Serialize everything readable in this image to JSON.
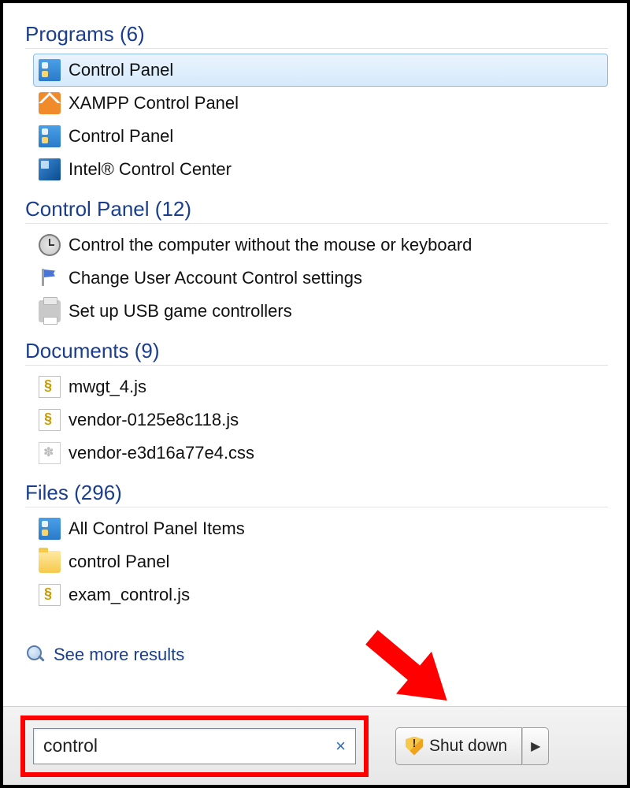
{
  "sections": {
    "programs": {
      "label": "Programs",
      "count": "(6)",
      "items": [
        {
          "label": "Control Panel",
          "icon": "cp",
          "selected": true
        },
        {
          "label": "XAMPP Control Panel",
          "icon": "xampp",
          "selected": false
        },
        {
          "label": "Control Panel",
          "icon": "cp",
          "selected": false
        },
        {
          "label": "Intel® Control Center",
          "icon": "intel",
          "selected": false
        }
      ]
    },
    "controlpanel": {
      "label": "Control Panel",
      "count": "(12)",
      "items": [
        {
          "label": "Control the computer without the mouse or keyboard",
          "icon": "clock"
        },
        {
          "label": "Change User Account Control settings",
          "icon": "flag"
        },
        {
          "label": "Set up USB game controllers",
          "icon": "printer"
        }
      ]
    },
    "documents": {
      "label": "Documents",
      "count": "(9)",
      "items": [
        {
          "label": "mwgt_4.js",
          "icon": "js"
        },
        {
          "label": "vendor-0125e8c118.js",
          "icon": "js"
        },
        {
          "label": "vendor-e3d16a77e4.css",
          "icon": "css"
        }
      ]
    },
    "files": {
      "label": "Files",
      "count": "(296)",
      "items": [
        {
          "label": "All Control Panel Items",
          "icon": "cp"
        },
        {
          "label": "control Panel",
          "icon": "folder"
        },
        {
          "label": "exam_control.js",
          "icon": "js"
        }
      ]
    }
  },
  "see_more": "See more results",
  "search": {
    "value": "control",
    "clear_glyph": "×"
  },
  "shutdown": {
    "label": "Shut down",
    "arrow_glyph": "▶"
  }
}
